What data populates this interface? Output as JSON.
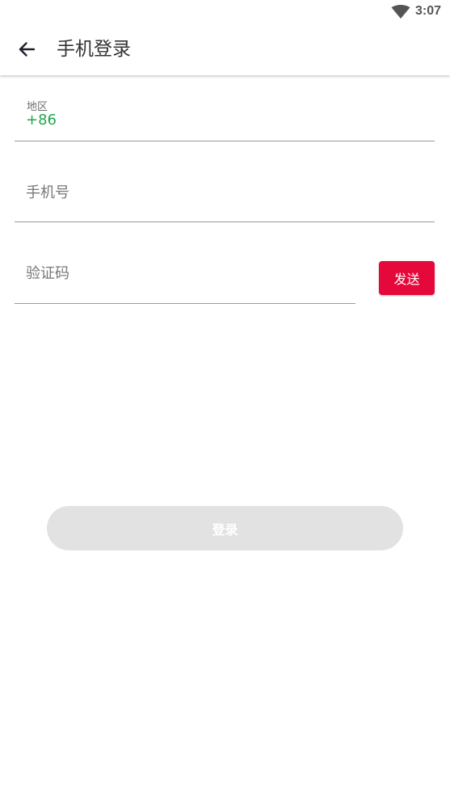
{
  "status_bar": {
    "time": "3:07",
    "wifi_icon": "wifi-icon"
  },
  "app_bar": {
    "back_icon": "arrow-back-icon",
    "title": "手机登录"
  },
  "form": {
    "region": {
      "label": "地区",
      "value": "+86"
    },
    "phone": {
      "placeholder": "手机号",
      "value": ""
    },
    "code": {
      "placeholder": "验证码",
      "value": ""
    },
    "send_label": "发送",
    "login_label": "登录"
  },
  "colors": {
    "accent": "#e5083a",
    "region_value": "#1ea84a",
    "login_disabled": "#e2e2e2"
  }
}
